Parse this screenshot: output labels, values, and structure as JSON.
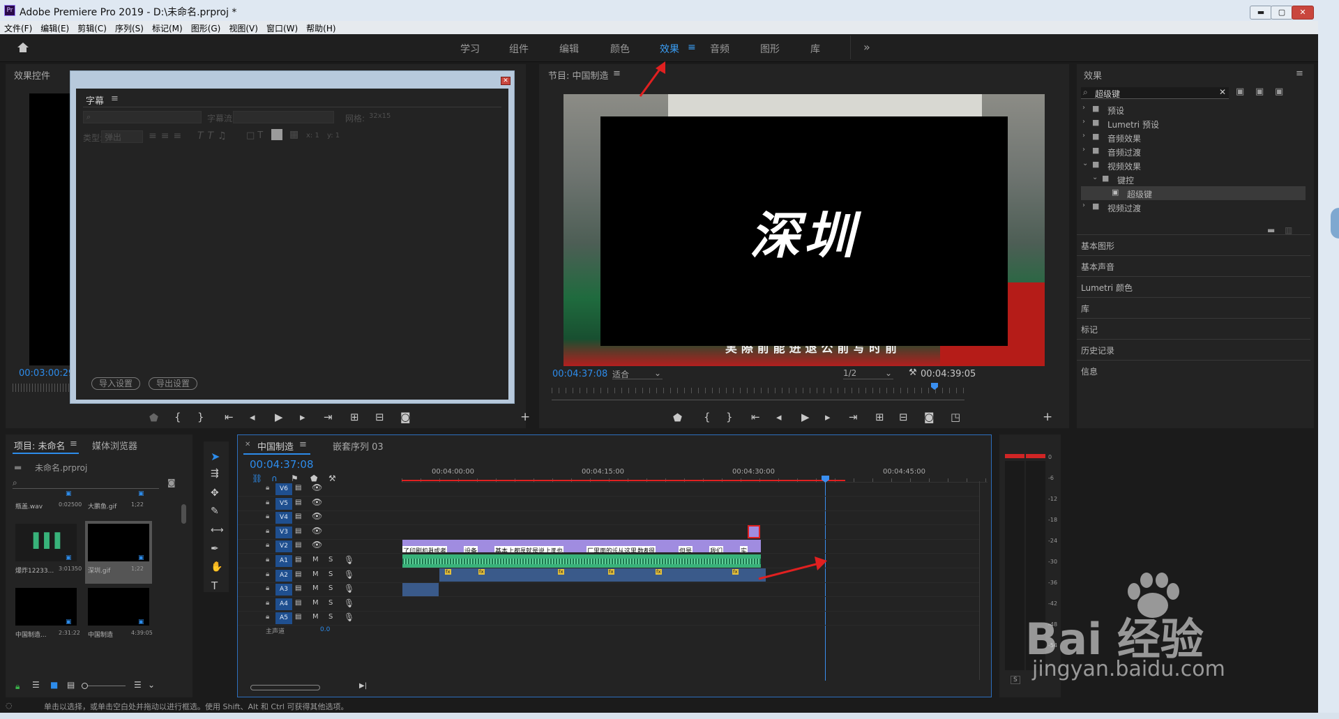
{
  "window": {
    "title": "Adobe Premiere Pro 2019 - D:\\未命名.prproj *",
    "min": "▬",
    "max": "▢",
    "close": "✕"
  },
  "menus": [
    "文件(F)",
    "编辑(E)",
    "剪辑(C)",
    "序列(S)",
    "标记(M)",
    "图形(G)",
    "视图(V)",
    "窗口(W)",
    "帮助(H)"
  ],
  "workspaces": [
    "学习",
    "组件",
    "编辑",
    "颜色",
    "效果",
    "音频",
    "图形",
    "库"
  ],
  "workspace_more": "»",
  "active_workspace": "效果",
  "effect_controls": {
    "title": "效果控件",
    "timecode": "00:03:00:29"
  },
  "titler": {
    "title": "字幕",
    "menu": "≡",
    "font_label": "字幕流:",
    "grid_label": "网格:",
    "grid_value": "32x15",
    "type_label": "类型:",
    "type_value": "弹出",
    "x_label": "x: 1",
    "y_label": "y: 1",
    "import_btn": "导入设置",
    "export_btn": "导出设置"
  },
  "program": {
    "title": "节目: 中国制造",
    "menu": "≡",
    "overlay_text": "深圳",
    "subtitle": "実 際 前 能 进 退 公 前 写 时 前",
    "timecode": "00:04:37:08",
    "fit": "适合",
    "resolution": "1/2",
    "duration": "00:04:39:05"
  },
  "effects": {
    "title": "效果",
    "menu": "≡",
    "search": "超级键",
    "tree": [
      {
        "label": "预设",
        "level": 0,
        "open": false
      },
      {
        "label": "Lumetri 预设",
        "level": 0,
        "open": false
      },
      {
        "label": "音频效果",
        "level": 0,
        "open": false
      },
      {
        "label": "音频过渡",
        "level": 0,
        "open": false
      },
      {
        "label": "视频效果",
        "level": 0,
        "open": true
      },
      {
        "label": "键控",
        "level": 1,
        "open": true
      },
      {
        "label": "超级键",
        "level": 2,
        "open": false
      },
      {
        "label": "视频过渡",
        "level": 0,
        "open": false
      }
    ],
    "panels": [
      "基本图形",
      "基本声音",
      "Lumetri 颜色",
      "库",
      "标记",
      "历史记录",
      "信息"
    ]
  },
  "project": {
    "title": "项目: 未命名",
    "tab2": "媒体浏览器",
    "file": "未命名.prproj",
    "items": [
      {
        "name": "瓶盖.wav",
        "dur": "0:02500"
      },
      {
        "name": "大鹏鱼.gif",
        "dur": "1;22"
      },
      {
        "name": "爆炸12233...",
        "dur": "3:01350"
      },
      {
        "name": "深圳.gif",
        "dur": "1;22"
      },
      {
        "name": "中国制造...",
        "dur": "2:31:22"
      },
      {
        "name": "中国制造",
        "dur": "4:39:05"
      }
    ]
  },
  "timeline": {
    "tab": "中国制造",
    "tab2": "嵌套序列 03",
    "timecode": "00:04:37:08",
    "ruler": [
      "00:04:00:00",
      "00:04:15:00",
      "00:04:30:00",
      "00:04:45:00"
    ],
    "video_tracks": [
      "V6",
      "V5",
      "V4",
      "V3",
      "V2"
    ],
    "audio_tracks": [
      "A1",
      "A2",
      "A3",
      "A4",
      "A5"
    ],
    "master": "主声道",
    "master_val": "0.0",
    "subtitle_segments": [
      "了印刷机器",
      "或者",
      "设备",
      "基本上都是进",
      "就是说上面",
      "也",
      "厂里面的设备大多数都",
      "从这里",
      "很",
      "但是",
      "我们",
      "实"
    ]
  },
  "meter": {
    "scale": [
      "0",
      "-6",
      "-12",
      "-18",
      "-24",
      "-30",
      "-36",
      "-42",
      "-48",
      "-54"
    ],
    "solo": "S"
  },
  "status": {
    "text": "单击以选择，或单击空白处并拖动以进行框选。使用 Shift、Alt 和 Ctrl 可获得其他选项。"
  },
  "watermark": {
    "brand": "Bai 经验",
    "url": "jingyan.baidu.com"
  },
  "colors": {
    "accent": "#2d8ceb",
    "clip_purple": "#a08ce0",
    "audio_green": "#38b27a",
    "audio_blue": "#3a5a8a",
    "annotation": "#e02020"
  }
}
